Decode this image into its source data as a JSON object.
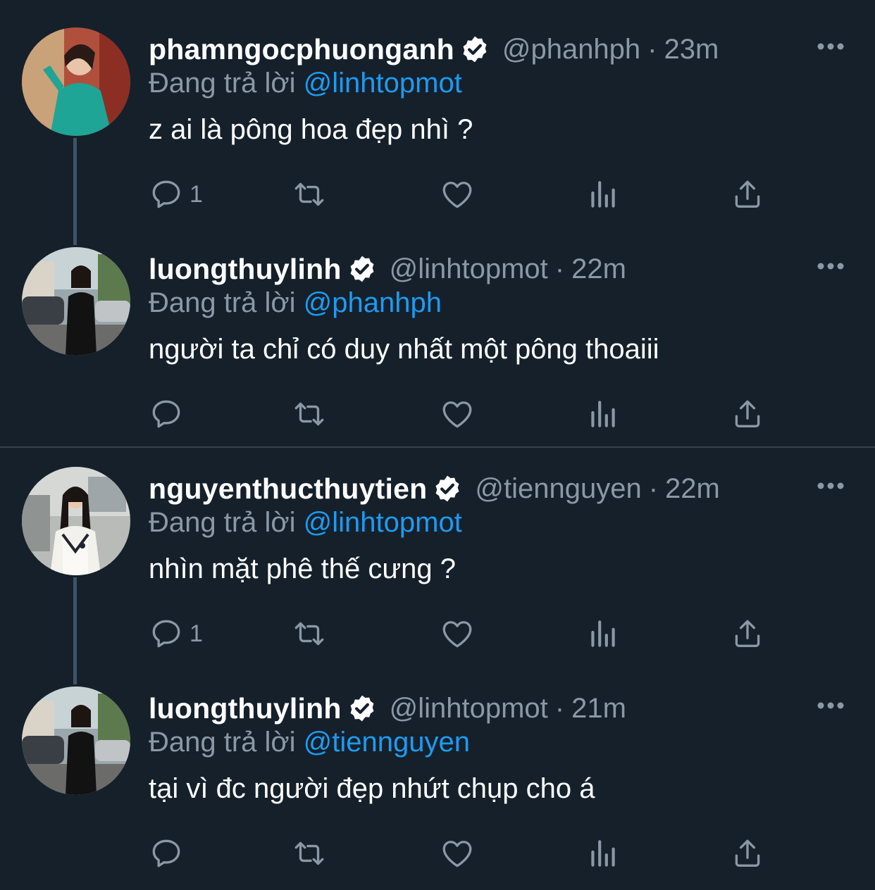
{
  "tweets": [
    {
      "name": "phamngocphuonganh",
      "handle": "@phanhph",
      "dot": "·",
      "time": "23m",
      "reply_prefix": "Đang trả lời",
      "reply_to": "@linhtopmot",
      "text": "z ai là pông hoa đẹp nhì ?",
      "reply_count": "1"
    },
    {
      "name": "luongthuylinh",
      "handle": "@linhtopmot",
      "dot": "·",
      "time": "22m",
      "reply_prefix": "Đang trả lời",
      "reply_to": "@phanhph",
      "text": "người ta chỉ có duy nhất một pông thoaiii",
      "reply_count": ""
    },
    {
      "name": "nguyenthucthuytien",
      "handle": "@tiennguyen",
      "dot": "·",
      "time": "22m",
      "reply_prefix": "Đang trả lời",
      "reply_to": "@linhtopmot",
      "text": "nhìn mặt phê thế cưng ?",
      "reply_count": "1"
    },
    {
      "name": "luongthuylinh",
      "handle": "@linhtopmot",
      "dot": "·",
      "time": "21m",
      "reply_prefix": "Đang trả lời",
      "reply_to": "@tiennguyen",
      "text": "tại vì đc người đẹp nhứt chụp cho á",
      "reply_count": ""
    }
  ],
  "icons": {
    "verified": "verified-badge-icon",
    "more": "more-options-icon",
    "reply": "reply-icon",
    "retweet": "retweet-icon",
    "like": "like-icon",
    "analytics": "analytics-icon",
    "share": "share-icon"
  },
  "colors": {
    "background": "#15202b",
    "muted": "#8b98a5",
    "mention": "#1d9bf0",
    "divider": "#38444d"
  }
}
